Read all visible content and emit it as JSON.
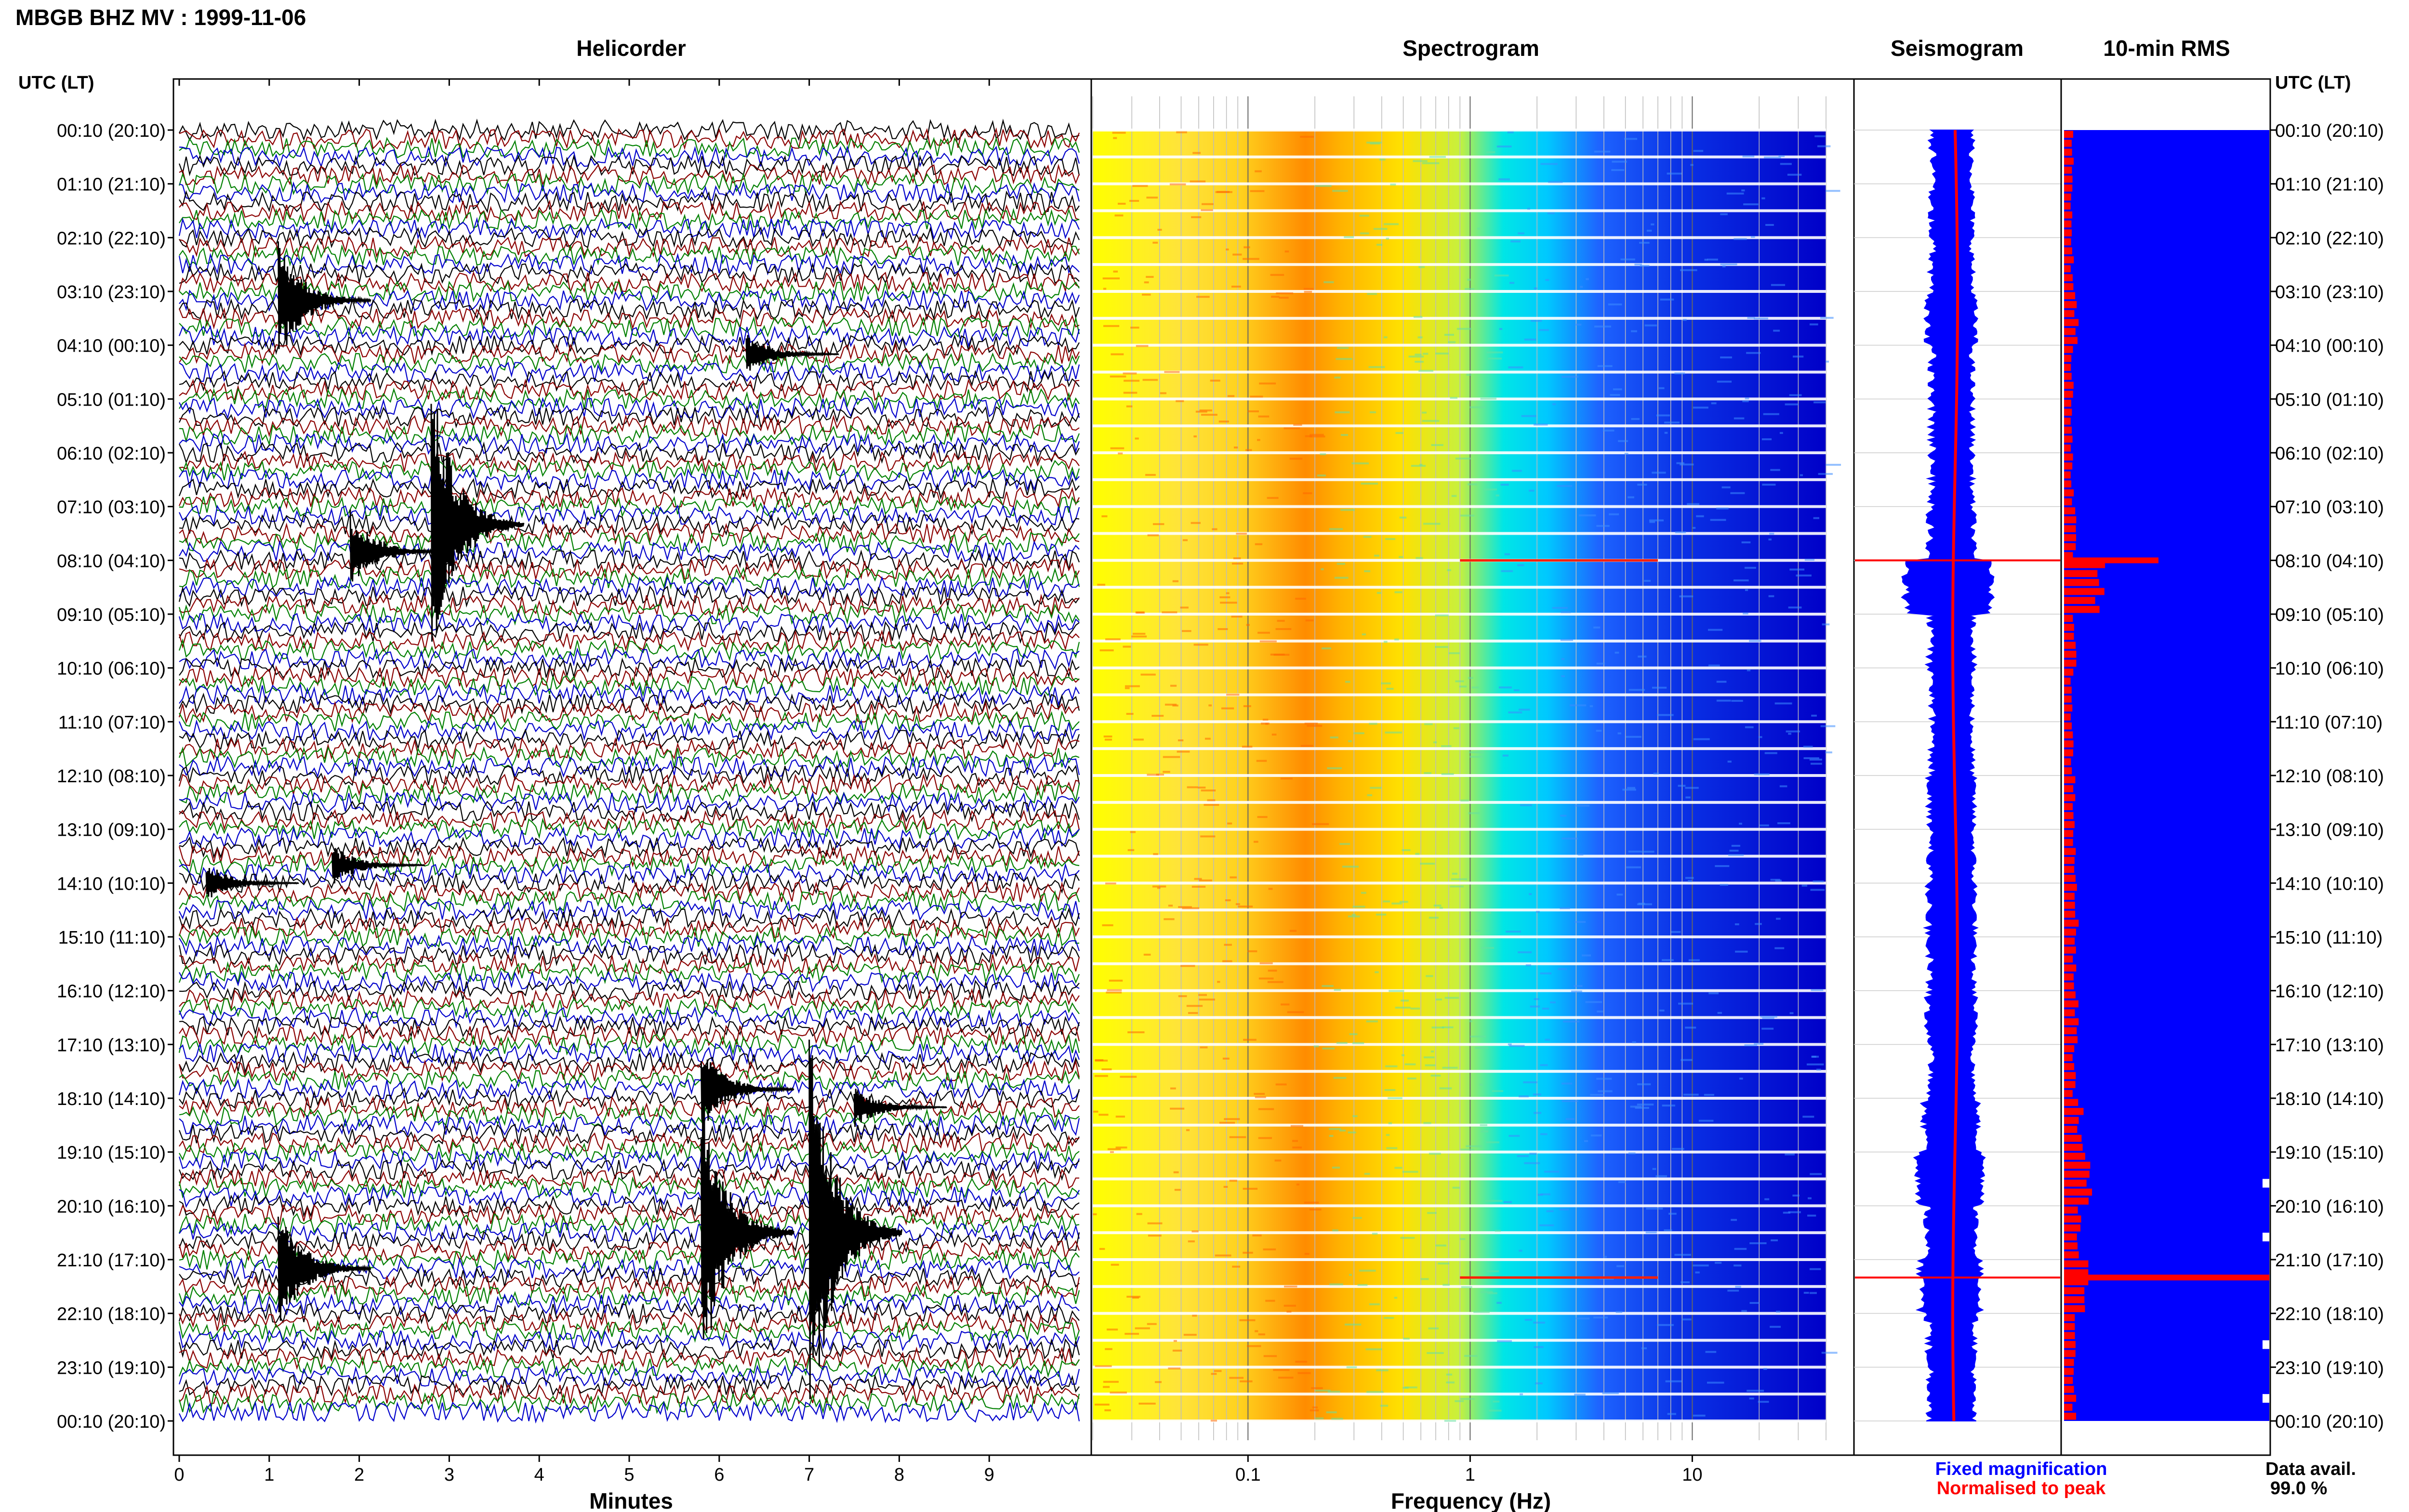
{
  "header": {
    "title": "MBGB BHZ MV : 1999-11-06"
  },
  "time_axis": {
    "label_left": "UTC (LT)",
    "label_right": "UTC (LT)",
    "ticks": [
      "00:10 (20:10)",
      "01:10 (21:10)",
      "02:10 (22:10)",
      "03:10 (23:10)",
      "04:10 (00:10)",
      "05:10 (01:10)",
      "06:10 (02:10)",
      "07:10 (03:10)",
      "08:10 (04:10)",
      "09:10 (05:10)",
      "10:10 (06:10)",
      "11:10 (07:10)",
      "12:10 (08:10)",
      "13:10 (09:10)",
      "14:10 (10:10)",
      "15:10 (11:10)",
      "16:10 (12:10)",
      "17:10 (13:10)",
      "18:10 (14:10)",
      "19:10 (15:10)",
      "20:10 (16:10)",
      "21:10 (17:10)",
      "22:10 (18:10)",
      "23:10 (19:10)",
      "00:10 (20:10)"
    ]
  },
  "chart_data": [
    {
      "type": "line",
      "title": "Helicorder",
      "xlabel": "Minutes",
      "x_ticks": [
        "0",
        "1",
        "2",
        "3",
        "4",
        "5",
        "6",
        "7",
        "8",
        "9"
      ],
      "xlim": [
        0,
        10
      ],
      "rows": 144,
      "row_colors": [
        "#000000",
        "#8b0000",
        "#008000",
        "#0000cc"
      ],
      "events": [
        {
          "time": "03:20",
          "minute": 1.1,
          "amplitude": 3
        },
        {
          "time": "04:20",
          "minute": 6.3,
          "amplitude": 1
        },
        {
          "time": "07:30",
          "minute": 2.8,
          "amplitude": 7
        },
        {
          "time": "08:00",
          "minute": 1.9,
          "amplitude": 2
        },
        {
          "time": "13:50",
          "minute": 1.7,
          "amplitude": 1
        },
        {
          "time": "14:10",
          "minute": 0.3,
          "amplitude": 1
        },
        {
          "time": "18:00",
          "minute": 5.8,
          "amplitude": 2
        },
        {
          "time": "18:20",
          "minute": 7.5,
          "amplitude": 1
        },
        {
          "time": "20:40",
          "minute": 5.8,
          "amplitude": 7
        },
        {
          "time": "20:40",
          "minute": 7.0,
          "amplitude": 10
        },
        {
          "time": "21:20",
          "minute": 1.1,
          "amplitude": 3
        }
      ]
    },
    {
      "type": "heatmap",
      "title": "Spectrogram",
      "xlabel": "Frequency (Hz)",
      "x_scale": "log",
      "xlim": [
        0.02,
        40
      ],
      "x_ticks": [
        "0.1",
        "1",
        "10"
      ],
      "colormap": [
        "#ffff00",
        "#ff8c00",
        "#ffd21e",
        "#00e6e6",
        "#1e64ff",
        "#0000c8"
      ]
    },
    {
      "type": "line",
      "title": "Seismogram",
      "series": [
        {
          "name": "Fixed magnification",
          "color": "#0000ff"
        },
        {
          "name": "Normalised to peak",
          "color": "#ff0000"
        }
      ]
    },
    {
      "type": "bar",
      "title": "10-min RMS",
      "series_colors": {
        "bar": "#ff0000",
        "fill": "#0000ff"
      },
      "relative_values_hourly": [
        0.04,
        0.04,
        0.04,
        0.06,
        0.04,
        0.04,
        0.04,
        0.05,
        0.18,
        0.05,
        0.04,
        0.04,
        0.05,
        0.05,
        0.06,
        0.05,
        0.06,
        0.05,
        0.08,
        0.12,
        0.07,
        0.1,
        0.06,
        0.05
      ],
      "peaks": [
        {
          "time": "08:10",
          "value": 0.46
        },
        {
          "time": "21:30",
          "value": 1.0
        }
      ]
    }
  ],
  "legend": {
    "fixed": "Fixed magnification",
    "normalised": "Normalised to peak",
    "avail_label": "Data avail.",
    "avail_value": "99.0 %"
  },
  "colors": {
    "fixed": "#0000ff",
    "normalised": "#ff0000"
  }
}
